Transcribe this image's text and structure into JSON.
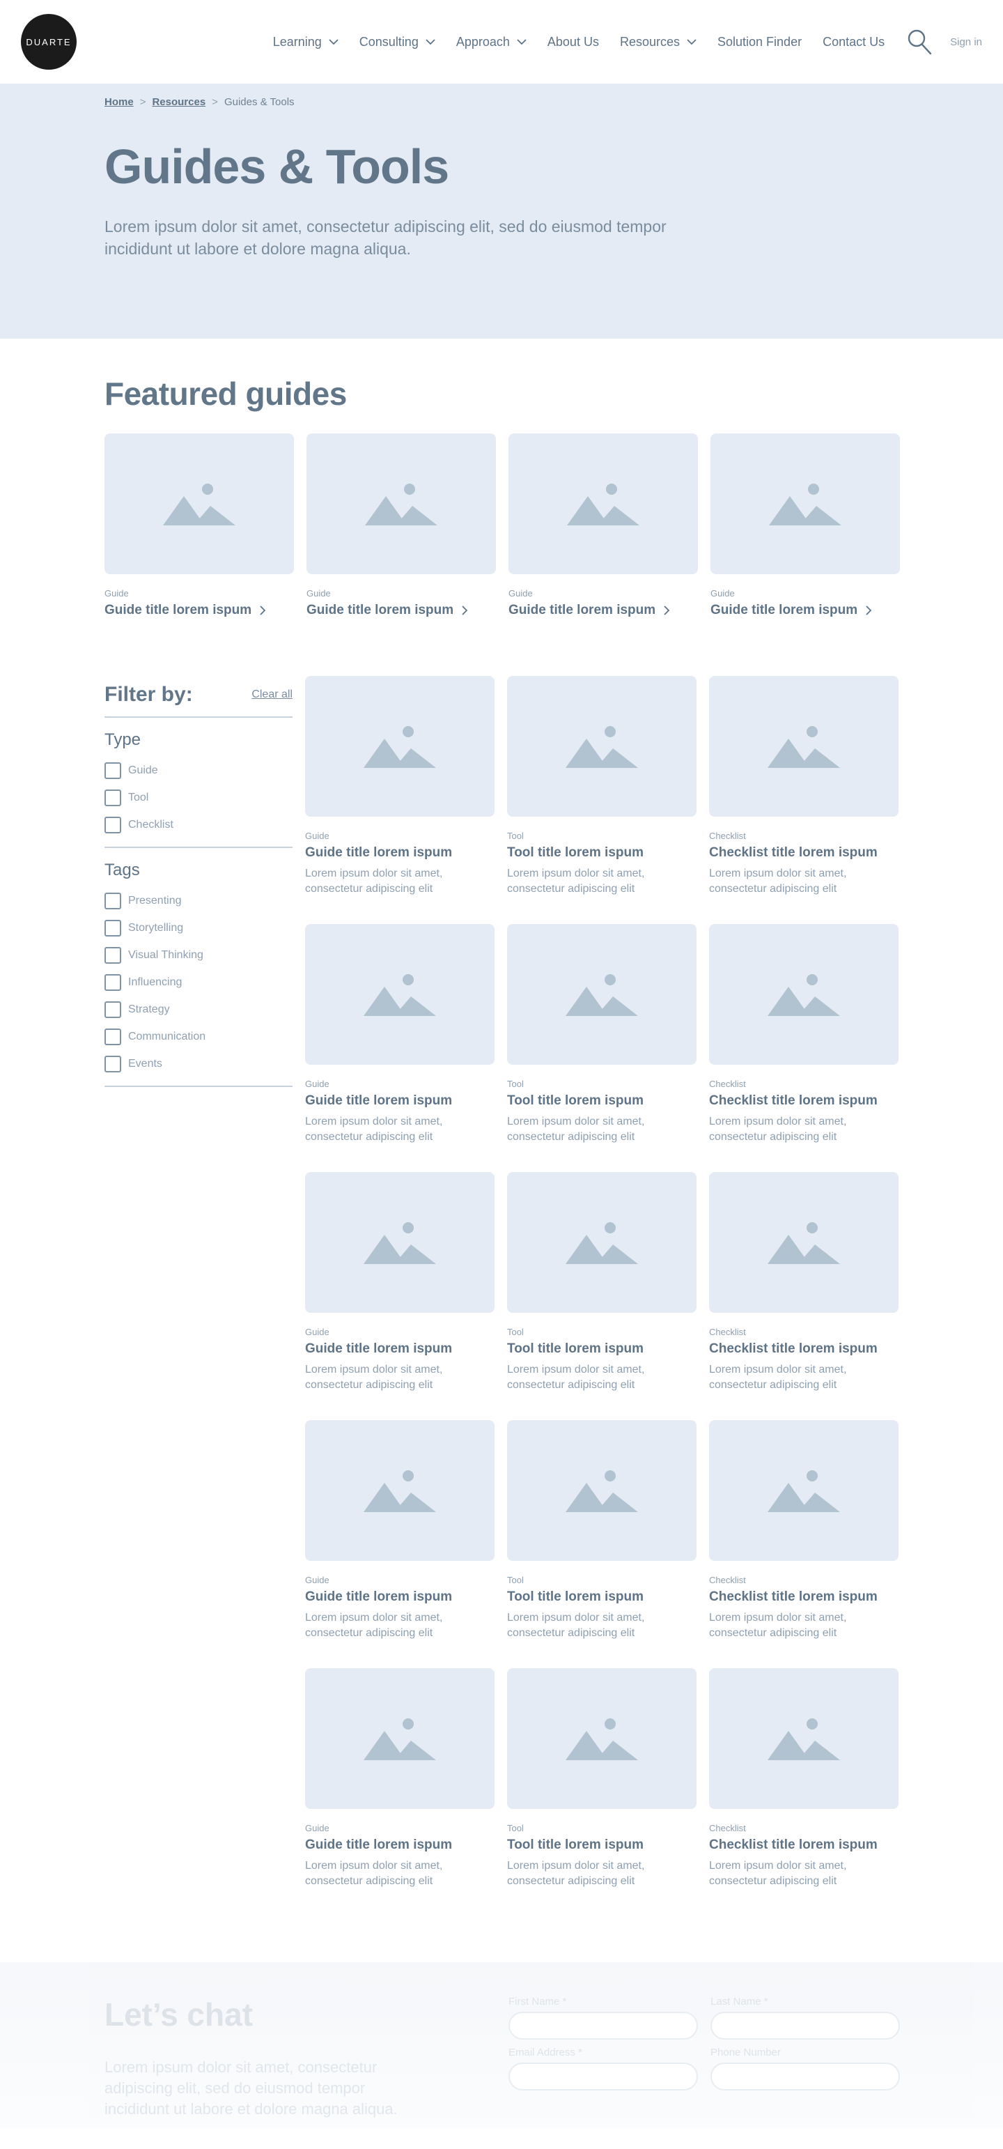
{
  "header": {
    "logo_text": "DUARTE",
    "nav": [
      {
        "label": "Learning",
        "dropdown": true
      },
      {
        "label": "Consulting",
        "dropdown": true
      },
      {
        "label": "Approach",
        "dropdown": true
      },
      {
        "label": "About Us",
        "dropdown": false
      },
      {
        "label": "Resources",
        "dropdown": true
      },
      {
        "label": "Solution Finder",
        "dropdown": false
      },
      {
        "label": "Contact Us",
        "dropdown": false
      }
    ],
    "search_icon": "search-icon",
    "signin_label": "Sign in"
  },
  "hero": {
    "breadcrumb": {
      "home": "Home",
      "resources": "Resources",
      "current": "Guides & Tools",
      "separator": ">"
    },
    "title": "Guides & Tools",
    "description": "Lorem ipsum dolor sit amet, consectetur adipiscing elit, sed do eiusmod tempor incididunt ut labore et dolore magna aliqua."
  },
  "featured": {
    "title": "Featured guides",
    "cards": [
      {
        "type": "Guide",
        "title": "Guide title lorem ispum"
      },
      {
        "type": "Guide",
        "title": "Guide title lorem ispum"
      },
      {
        "type": "Guide",
        "title": "Guide title lorem ispum"
      },
      {
        "type": "Guide",
        "title": "Guide title lorem ispum"
      }
    ]
  },
  "filters": {
    "title": "Filter by:",
    "clear_all": "Clear all",
    "type": {
      "title": "Type",
      "options": [
        "Guide",
        "Tool",
        "Checklist"
      ]
    },
    "tags": {
      "title": "Tags",
      "options": [
        "Presenting",
        "Storytelling",
        "Visual Thinking",
        "Influencing",
        "Strategy",
        "Communication",
        "Events"
      ]
    }
  },
  "results": [
    {
      "type": "Guide",
      "title": "Guide title lorem ispum",
      "desc": "Lorem ipsum dolor sit amet, consectetur adipiscing elit"
    },
    {
      "type": "Tool",
      "title": "Tool title lorem ispum",
      "desc": "Lorem ipsum dolor sit amet, consectetur adipiscing elit"
    },
    {
      "type": "Checklist",
      "title": "Checklist title lorem ispum",
      "desc": "Lorem ipsum dolor sit amet, consectetur adipiscing elit"
    },
    {
      "type": "Guide",
      "title": "Guide title lorem ispum",
      "desc": "Lorem ipsum dolor sit amet, consectetur adipiscing elit"
    },
    {
      "type": "Tool",
      "title": "Tool title lorem ispum",
      "desc": "Lorem ipsum dolor sit amet, consectetur adipiscing elit"
    },
    {
      "type": "Checklist",
      "title": "Checklist title lorem ispum",
      "desc": "Lorem ipsum dolor sit amet, consectetur adipiscing elit"
    },
    {
      "type": "Guide",
      "title": "Guide title lorem ispum",
      "desc": "Lorem ipsum dolor sit amet, consectetur adipiscing elit"
    },
    {
      "type": "Tool",
      "title": "Tool title lorem ispum",
      "desc": "Lorem ipsum dolor sit amet, consectetur adipiscing elit"
    },
    {
      "type": "Checklist",
      "title": "Checklist title lorem ispum",
      "desc": "Lorem ipsum dolor sit amet, consectetur adipiscing elit"
    },
    {
      "type": "Guide",
      "title": "Guide title lorem ispum",
      "desc": "Lorem ipsum dolor sit amet, consectetur adipiscing elit"
    },
    {
      "type": "Tool",
      "title": "Tool title lorem ispum",
      "desc": "Lorem ipsum dolor sit amet, consectetur adipiscing elit"
    },
    {
      "type": "Checklist",
      "title": "Checklist title lorem ispum",
      "desc": "Lorem ipsum dolor sit amet, consectetur adipiscing elit"
    },
    {
      "type": "Guide",
      "title": "Guide title lorem ispum",
      "desc": "Lorem ipsum dolor sit amet, consectetur adipiscing elit"
    },
    {
      "type": "Tool",
      "title": "Tool title lorem ispum",
      "desc": "Lorem ipsum dolor sit amet, consectetur adipiscing elit"
    },
    {
      "type": "Checklist",
      "title": "Checklist title lorem ispum",
      "desc": "Lorem ipsum dolor sit amet, consectetur adipiscing elit"
    }
  ],
  "chat": {
    "title": "Let’s chat",
    "description": "Lorem ipsum dolor sit amet, consectetur adipiscing elit, sed do eiusmod tempor incididunt ut labore et dolore magna aliqua.",
    "fields": [
      {
        "label": "First Name *"
      },
      {
        "label": "Last Name *"
      },
      {
        "label": "Email Address *"
      },
      {
        "label": "Phone Number"
      }
    ]
  },
  "colors": {
    "hero_bg": "#e4ebf4",
    "text_primary": "#5f7386",
    "text_muted": "#8fa0b0",
    "placeholder_art": "#b1c2d0",
    "logo_bg": "#1b1b1b"
  }
}
